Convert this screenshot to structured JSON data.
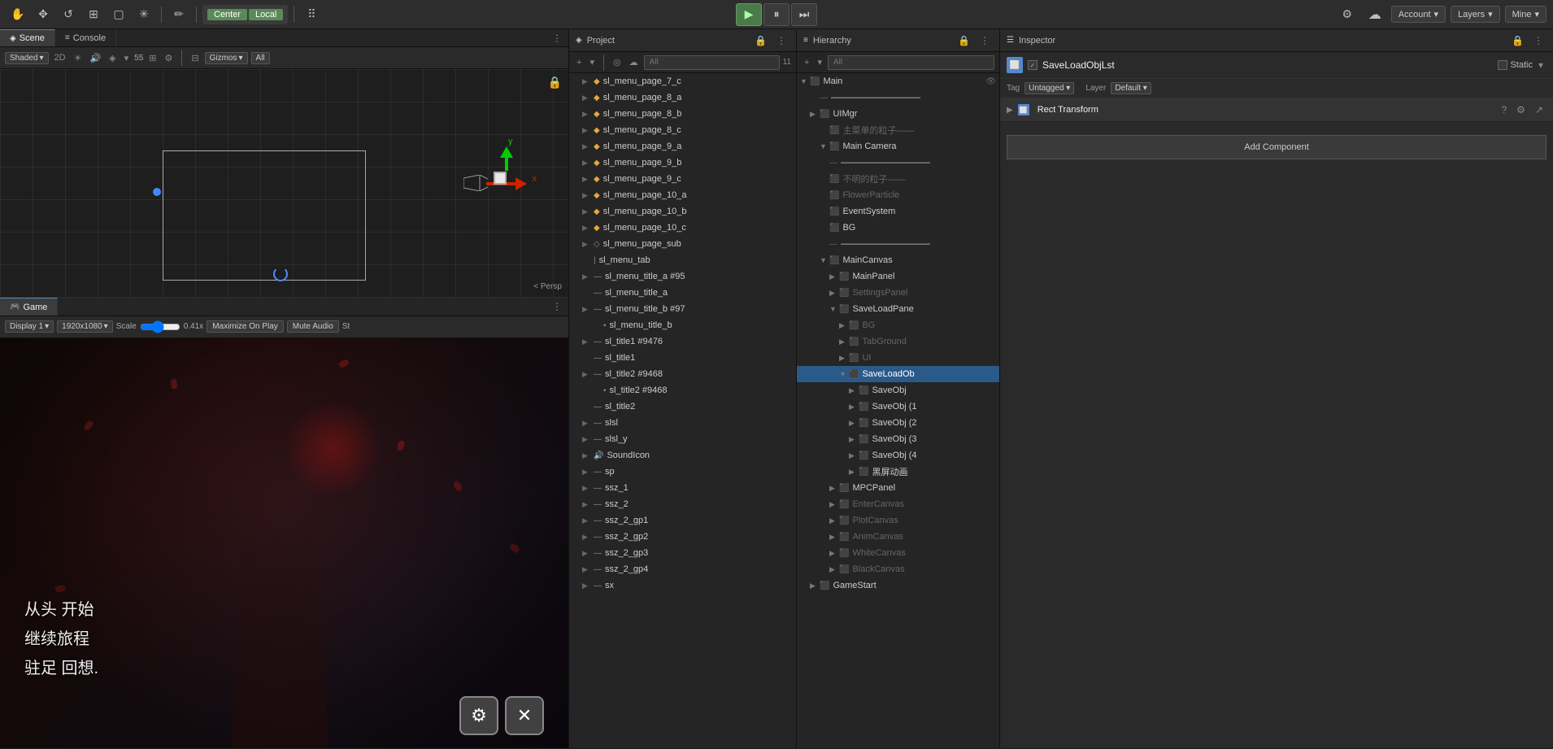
{
  "topbar": {
    "tools": [
      {
        "name": "hand",
        "icon": "✋",
        "active": false
      },
      {
        "name": "move",
        "icon": "✥",
        "active": false
      },
      {
        "name": "rotate",
        "icon": "↺",
        "active": false
      },
      {
        "name": "scale",
        "icon": "⊞",
        "active": false
      },
      {
        "name": "rect",
        "icon": "▢",
        "active": false
      },
      {
        "name": "transform",
        "icon": "✳",
        "active": false
      },
      {
        "name": "custom",
        "icon": "✏",
        "active": false
      }
    ],
    "pivot_center": "Center",
    "pivot_local": "Local",
    "pivot_grid": "⠿",
    "play_icon": "▶",
    "pause_icon": "⏸",
    "step_icon": "⏭",
    "cloud_icon": "☁",
    "collab_icon": "⚙",
    "account_label": "Account",
    "layers_label": "Layers",
    "mine_label": "Mine"
  },
  "tabs": {
    "scene_label": "Scene",
    "scene_icon": "◈",
    "console_label": "Console",
    "console_icon": "≡",
    "project_label": "Project",
    "project_icon": "◈",
    "hierarchy_label": "Hierarchy",
    "hierarchy_icon": "≡",
    "inspector_label": "Inspector",
    "inspector_icon": "☰"
  },
  "scene": {
    "shading": "Shaded",
    "mode_2d": "2D",
    "gizmos": "Gizmos",
    "all": "All",
    "persp": "< Persp"
  },
  "game": {
    "display": "Display 1",
    "resolution": "1920x1080",
    "scale_label": "Scale",
    "scale_value": "0.41x",
    "maximize": "Maximize On Play",
    "mute": "Mute Audio",
    "st": "St",
    "text_lines": [
      "从头 开始",
      "继续旅程",
      "驻足 回想."
    ]
  },
  "project": {
    "title": "Project",
    "items": [
      {
        "indent": 1,
        "arrow": "▶",
        "icon": "◆",
        "icon_color": "diamond",
        "name": "sl_menu_page_7_c"
      },
      {
        "indent": 1,
        "arrow": "▶",
        "icon": "◆",
        "icon_color": "diamond",
        "name": "sl_menu_page_8_a"
      },
      {
        "indent": 1,
        "arrow": "▶",
        "icon": "◆",
        "icon_color": "diamond",
        "name": "sl_menu_page_8_b"
      },
      {
        "indent": 1,
        "arrow": "▶",
        "icon": "◆",
        "icon_color": "diamond",
        "name": "sl_menu_page_8_c"
      },
      {
        "indent": 1,
        "arrow": "▶",
        "icon": "◆",
        "icon_color": "diamond",
        "name": "sl_menu_page_9_a"
      },
      {
        "indent": 1,
        "arrow": "▶",
        "icon": "◆",
        "icon_color": "diamond",
        "name": "sl_menu_page_9_b"
      },
      {
        "indent": 1,
        "arrow": "▶",
        "icon": "◆",
        "icon_color": "diamond",
        "name": "sl_menu_page_9_c"
      },
      {
        "indent": 1,
        "arrow": "▶",
        "icon": "◆",
        "icon_color": "diamond",
        "name": "sl_menu_page_10_a"
      },
      {
        "indent": 1,
        "arrow": "▶",
        "icon": "◆",
        "icon_color": "diamond",
        "name": "sl_menu_page_10_b"
      },
      {
        "indent": 1,
        "arrow": "▶",
        "icon": "◆",
        "icon_color": "diamond",
        "name": "sl_menu_page_10_c"
      },
      {
        "indent": 1,
        "arrow": "▶",
        "icon": "◇",
        "icon_color": "gray",
        "name": "sl_menu_page_sub"
      },
      {
        "indent": 1,
        "arrow": "",
        "icon": "|",
        "icon_color": "gray",
        "name": "sl_menu_tab"
      },
      {
        "indent": 1,
        "arrow": "▶",
        "icon": "—",
        "icon_color": "gray",
        "name": "sl_menu_title_a #95"
      },
      {
        "indent": 1,
        "arrow": "",
        "icon": "—",
        "icon_color": "gray",
        "name": "sl_menu_title_a"
      },
      {
        "indent": 1,
        "arrow": "▶",
        "icon": "—",
        "icon_color": "gray",
        "name": "sl_menu_title_b #97"
      },
      {
        "indent": 2,
        "arrow": "",
        "icon": "▪",
        "icon_color": "blue",
        "name": "sl_menu_title_b"
      },
      {
        "indent": 1,
        "arrow": "▶",
        "icon": "—",
        "icon_color": "gray",
        "name": "sl_title1 #9476"
      },
      {
        "indent": 1,
        "arrow": "",
        "icon": "—",
        "icon_color": "gray",
        "name": "sl_title1"
      },
      {
        "indent": 1,
        "arrow": "▶",
        "icon": "—",
        "icon_color": "gray",
        "name": "sl_title2 #9468"
      },
      {
        "indent": 2,
        "arrow": "",
        "icon": "▪",
        "icon_color": "blue",
        "name": "sl_title2 #9468"
      },
      {
        "indent": 1,
        "arrow": "",
        "icon": "—",
        "icon_color": "gray",
        "name": "sl_title2"
      },
      {
        "indent": 1,
        "arrow": "▶",
        "icon": "—",
        "icon_color": "gray",
        "name": "slsl"
      },
      {
        "indent": 1,
        "arrow": "▶",
        "icon": "—",
        "icon_color": "gray",
        "name": "slsl_y"
      },
      {
        "indent": 1,
        "arrow": "▶",
        "icon": "🔊",
        "icon_color": "gray",
        "name": "SoundIcon"
      },
      {
        "indent": 1,
        "arrow": "▶",
        "icon": "—",
        "icon_color": "gray",
        "name": "sp"
      },
      {
        "indent": 1,
        "arrow": "▶",
        "icon": "—",
        "icon_color": "gray",
        "name": "ssz_1"
      },
      {
        "indent": 1,
        "arrow": "▶",
        "icon": "—",
        "icon_color": "gray",
        "name": "ssz_2"
      },
      {
        "indent": 1,
        "arrow": "▶",
        "icon": "—",
        "icon_color": "gray",
        "name": "ssz_2_gp1"
      },
      {
        "indent": 1,
        "arrow": "▶",
        "icon": "—",
        "icon_color": "gray",
        "name": "ssz_2_gp2"
      },
      {
        "indent": 1,
        "arrow": "▶",
        "icon": "—",
        "icon_color": "gray",
        "name": "ssz_2_gp3"
      },
      {
        "indent": 1,
        "arrow": "▶",
        "icon": "—",
        "icon_color": "gray",
        "name": "ssz_2_gp4"
      },
      {
        "indent": 1,
        "arrow": "▶",
        "icon": "—",
        "icon_color": "gray",
        "name": "sx"
      }
    ]
  },
  "hierarchy": {
    "title": "Hierarchy",
    "search_placeholder": "All",
    "items": [
      {
        "indent": 0,
        "arrow": "▼",
        "icon": "cube",
        "name": "Main",
        "active": false,
        "has_eye": true
      },
      {
        "indent": 1,
        "arrow": "",
        "icon": "dash",
        "name": "——————————",
        "active": false,
        "has_eye": false
      },
      {
        "indent": 1,
        "arrow": "▶",
        "icon": "cube",
        "name": "UIMgr",
        "active": false,
        "has_eye": false
      },
      {
        "indent": 2,
        "arrow": "",
        "icon": "cube",
        "name": "主菜单的粒子——",
        "active": false,
        "has_eye": false,
        "disabled": true
      },
      {
        "indent": 2,
        "arrow": "▼",
        "icon": "cube",
        "name": "Main Camera",
        "active": false,
        "has_eye": false
      },
      {
        "indent": 2,
        "arrow": "",
        "icon": "dash2",
        "name": "——————————",
        "active": false,
        "has_eye": false
      },
      {
        "indent": 2,
        "arrow": "",
        "icon": "cube",
        "name": "不明的粒子——",
        "active": false,
        "has_eye": false,
        "disabled": true
      },
      {
        "indent": 2,
        "arrow": "",
        "icon": "cube",
        "name": "FlowerParticle",
        "active": false,
        "has_eye": false,
        "disabled": true
      },
      {
        "indent": 2,
        "arrow": "",
        "icon": "cube",
        "name": "EventSystem",
        "active": false,
        "has_eye": false
      },
      {
        "indent": 2,
        "arrow": "",
        "icon": "cube",
        "name": "BG",
        "active": false,
        "has_eye": false
      },
      {
        "indent": 2,
        "arrow": "",
        "icon": "dash2",
        "name": "——————————",
        "active": false,
        "has_eye": false
      },
      {
        "indent": 2,
        "arrow": "▼",
        "icon": "cube",
        "name": "MainCanvas",
        "active": false,
        "has_eye": false
      },
      {
        "indent": 3,
        "arrow": "▶",
        "icon": "cube",
        "name": "MainPanel",
        "active": false,
        "has_eye": false
      },
      {
        "indent": 3,
        "arrow": "▶",
        "icon": "cube",
        "name": "SettingsPanel",
        "active": false,
        "has_eye": false,
        "disabled": true
      },
      {
        "indent": 3,
        "arrow": "▼",
        "icon": "cube",
        "name": "SaveLoadPane",
        "active": false,
        "has_eye": false
      },
      {
        "indent": 4,
        "arrow": "▶",
        "icon": "cube",
        "name": "BG",
        "active": false,
        "has_eye": false,
        "disabled": true
      },
      {
        "indent": 4,
        "arrow": "▶",
        "icon": "cube",
        "name": "TabGround",
        "active": false,
        "has_eye": false,
        "disabled": true
      },
      {
        "indent": 4,
        "arrow": "▶",
        "icon": "cube",
        "name": "UI",
        "active": false,
        "has_eye": false,
        "disabled": true
      },
      {
        "indent": 4,
        "arrow": "▼",
        "icon": "cube",
        "name": "SaveLoadOb",
        "active": true,
        "has_eye": false
      },
      {
        "indent": 5,
        "arrow": "▶",
        "icon": "cube",
        "name": "SaveObj",
        "active": false,
        "has_eye": false
      },
      {
        "indent": 5,
        "arrow": "▶",
        "icon": "cube",
        "name": "SaveObj (1",
        "active": false,
        "has_eye": false
      },
      {
        "indent": 5,
        "arrow": "▶",
        "icon": "cube",
        "name": "SaveObj (2",
        "active": false,
        "has_eye": false
      },
      {
        "indent": 5,
        "arrow": "▶",
        "icon": "cube",
        "name": "SaveObj (3",
        "active": false,
        "has_eye": false
      },
      {
        "indent": 5,
        "arrow": "▶",
        "icon": "cube",
        "name": "SaveObj (4",
        "active": false,
        "has_eye": false
      },
      {
        "indent": 5,
        "arrow": "▶",
        "icon": "cube",
        "name": "黑屏动画",
        "active": false,
        "has_eye": false
      },
      {
        "indent": 3,
        "arrow": "▶",
        "icon": "cube",
        "name": "MPCPanel",
        "active": false,
        "has_eye": false
      },
      {
        "indent": 3,
        "arrow": "▶",
        "icon": "cube",
        "name": "EnterCanvas",
        "active": false,
        "has_eye": false,
        "disabled": true
      },
      {
        "indent": 3,
        "arrow": "▶",
        "icon": "cube",
        "name": "PlotCanvas",
        "active": false,
        "has_eye": false,
        "disabled": true
      },
      {
        "indent": 3,
        "arrow": "▶",
        "icon": "cube",
        "name": "AnimCanvas",
        "active": false,
        "has_eye": false,
        "disabled": true
      },
      {
        "indent": 3,
        "arrow": "▶",
        "icon": "cube",
        "name": "WhiteCanvas",
        "active": false,
        "has_eye": false,
        "disabled": true
      },
      {
        "indent": 3,
        "arrow": "▶",
        "icon": "cube",
        "name": "BlackCanvas",
        "active": false,
        "has_eye": false,
        "disabled": true
      },
      {
        "indent": 1,
        "arrow": "▶",
        "icon": "cube",
        "name": "GameStart",
        "active": false,
        "has_eye": false
      }
    ]
  },
  "inspector": {
    "title": "Inspector",
    "obj_name": "SaveLoadObjLst",
    "static_label": "Static",
    "tag_label": "Tag",
    "tag_value": "Untagged",
    "layer_label": "Layer",
    "layer_value": "Default",
    "component_title": "Rect Transform",
    "add_component_label": "Add Component",
    "help_icon": "?",
    "settings_icon": "⋮",
    "lock_icon": "🔒",
    "checkbox_checked": "✓"
  }
}
